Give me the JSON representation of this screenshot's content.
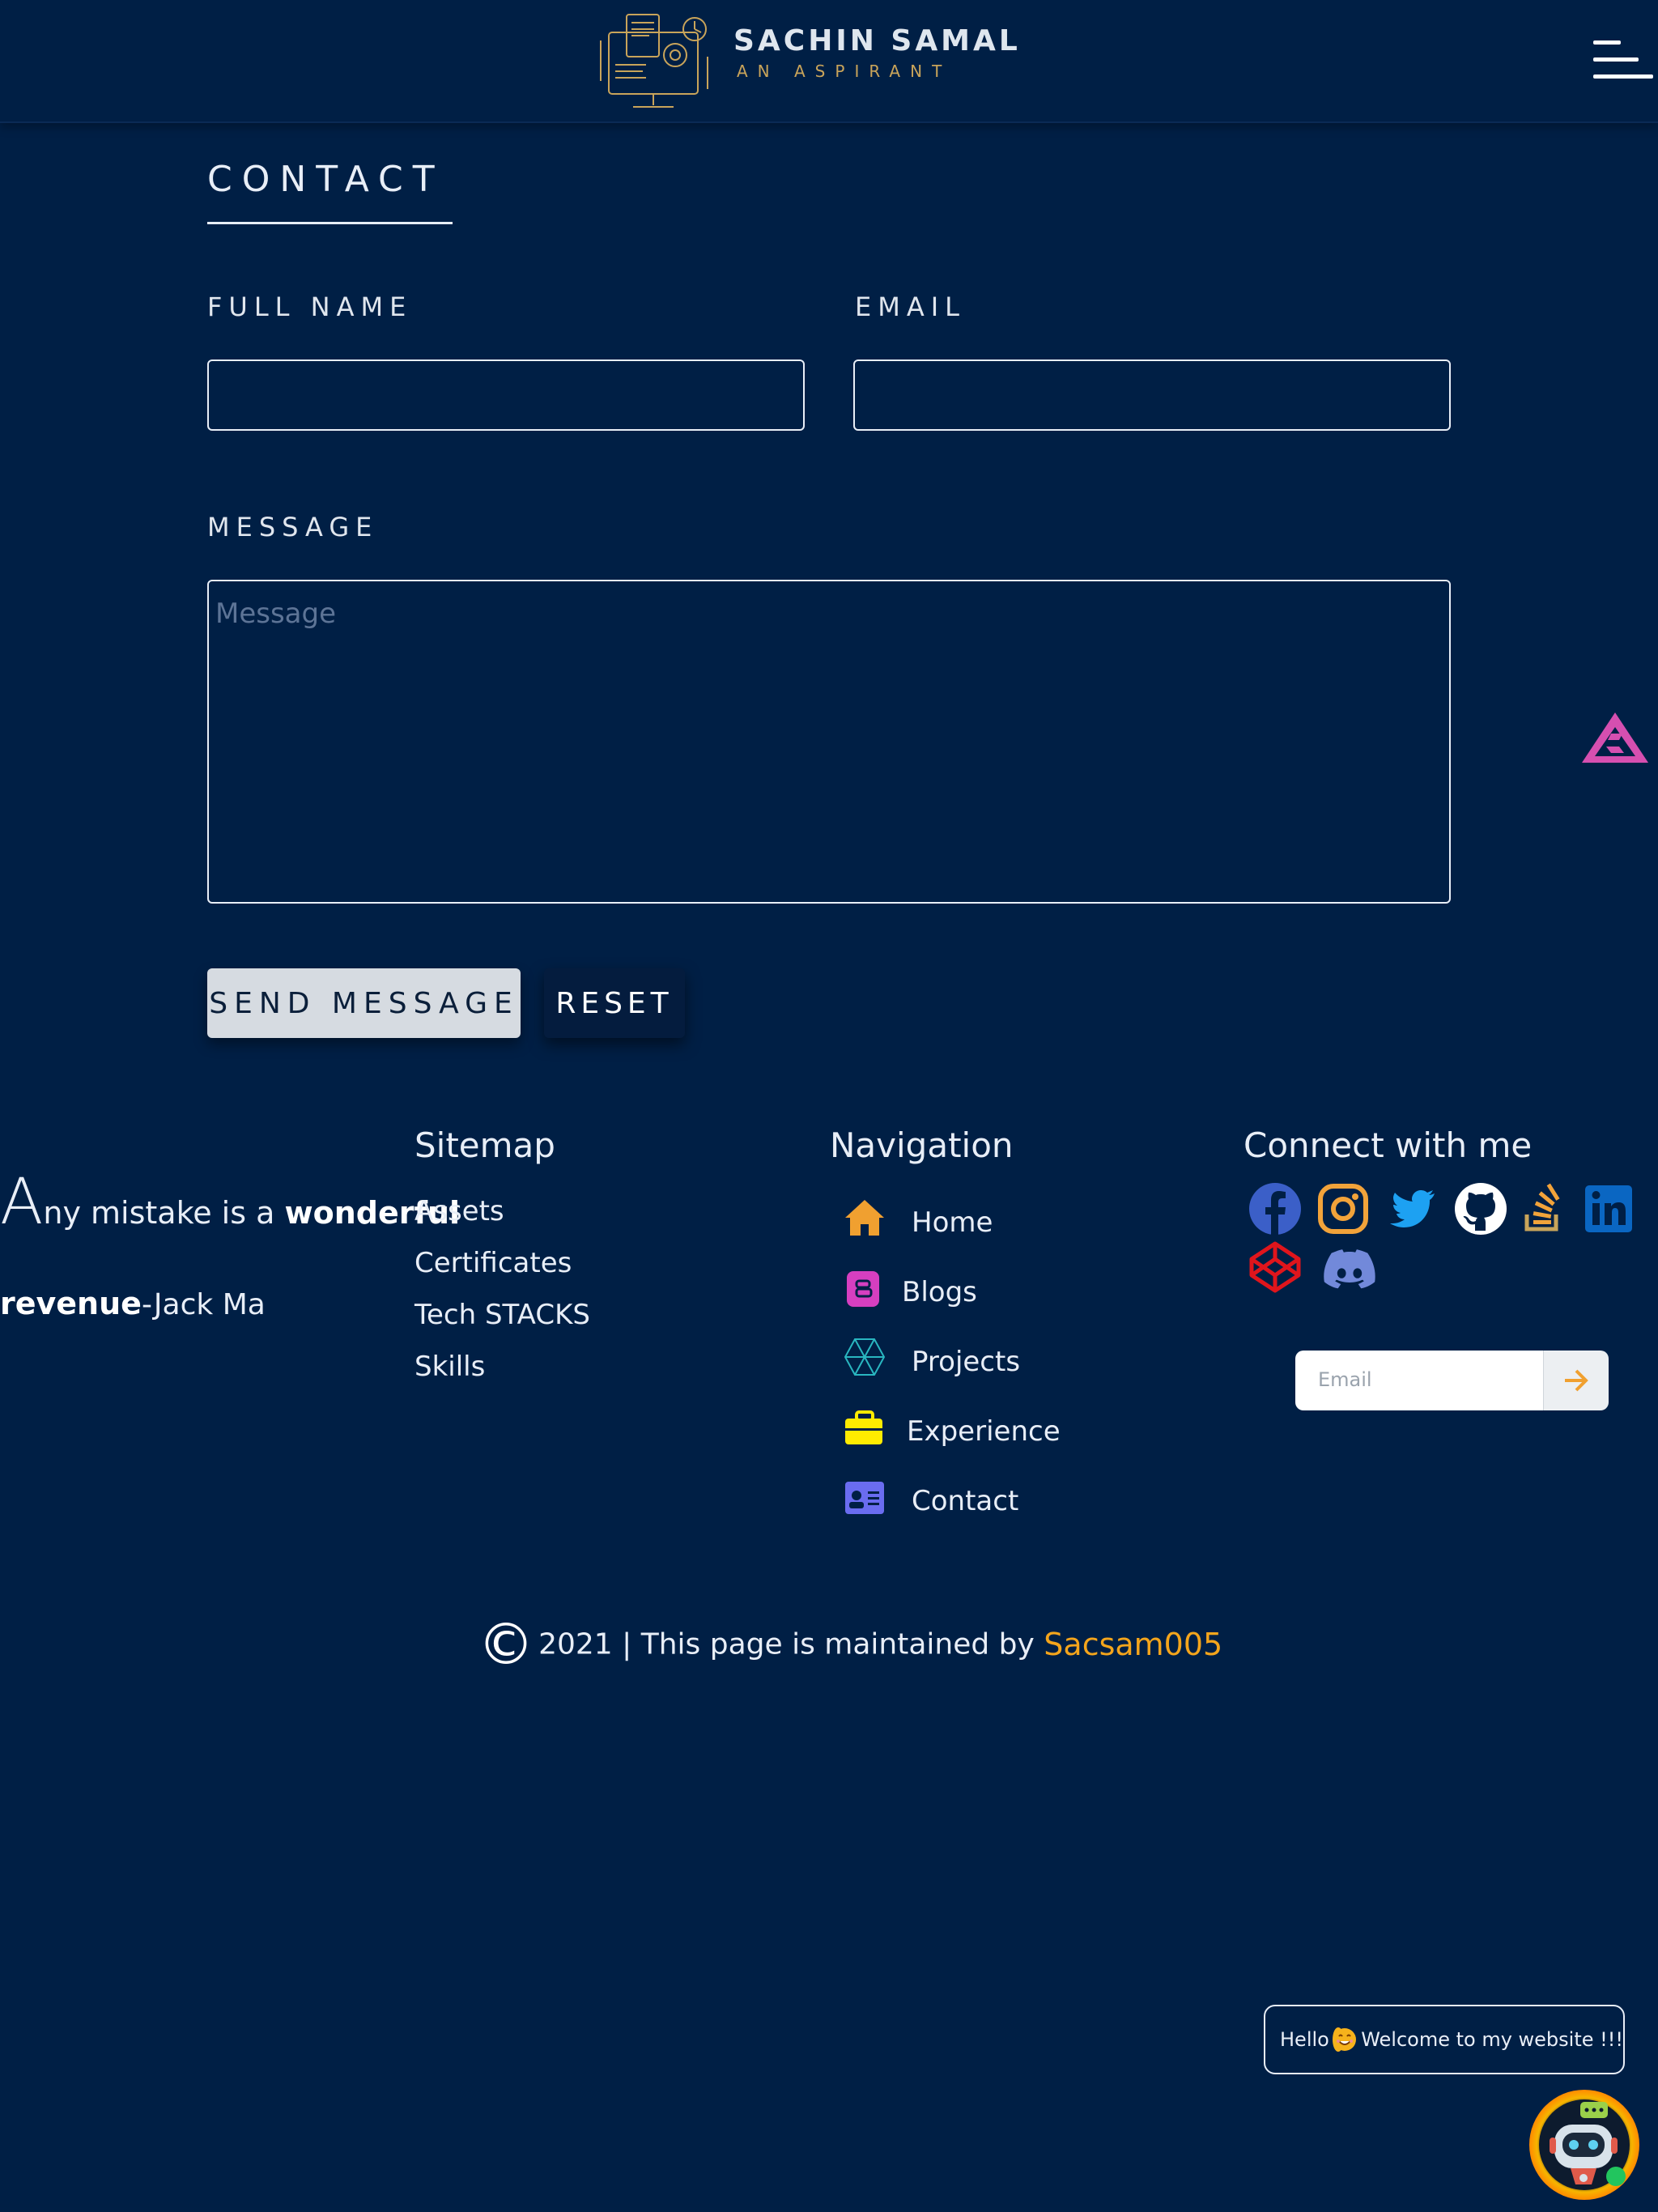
{
  "header": {
    "brand_name": "SACHIN SAMAL",
    "brand_tagline": "AN ASPIRANT",
    "menu_icon": "hamburger-menu-icon"
  },
  "contact": {
    "title": "CONTACT",
    "full_name_label": "FULL NAME",
    "full_name_value": "",
    "email_label": "EMAIL",
    "email_value": "",
    "message_label": "MESSAGE",
    "message_placeholder": "Message",
    "send_button": "SEND MESSAGE",
    "reset_button": "RESET"
  },
  "footer": {
    "quote": {
      "first_letter": "A",
      "part1": "ny mistake is a ",
      "highlight": "wonderful",
      "highlight2": "revenue",
      "author": "-Jack Ma"
    },
    "sitemap": {
      "title": "Sitemap",
      "links": [
        "Assets",
        "Certificates",
        "Tech STACKS",
        "Skills"
      ]
    },
    "navigation": {
      "title": "Navigation",
      "items": [
        {
          "label": "Home",
          "icon": "home-icon",
          "color": "#f0a030"
        },
        {
          "label": "Blogs",
          "icon": "blogger-icon",
          "color": "#d63fc0"
        },
        {
          "label": "Projects",
          "icon": "projects-icon",
          "color": "#29b6c0"
        },
        {
          "label": "Experience",
          "icon": "briefcase-icon",
          "color": "#ffeb00"
        },
        {
          "label": "Contact",
          "icon": "contact-card-icon",
          "color": "#6a6cf0"
        }
      ]
    },
    "connect": {
      "title": "Connect with me",
      "socials": [
        {
          "icon": "facebook-icon",
          "color": "#3b5fc8"
        },
        {
          "icon": "instagram-icon",
          "color": "#f2a33a"
        },
        {
          "icon": "twitter-icon",
          "color": "#1da1f2"
        },
        {
          "icon": "github-icon",
          "color": "#ffffff"
        },
        {
          "icon": "stackoverflow-icon",
          "color": "#f2a33a"
        },
        {
          "icon": "linkedin-icon",
          "color": "#0a66c2"
        },
        {
          "icon": "codepen-icon",
          "color": "#e0151c"
        },
        {
          "icon": "discord-icon",
          "color": "#7289da"
        }
      ],
      "newsletter_placeholder": "Email"
    },
    "copyright": {
      "symbol": "©",
      "text": "2021 | This page is maintained by ",
      "author": "Sacsam005"
    }
  },
  "chat": {
    "greeting_before": "Hello",
    "greeting_after": "! Welcome to my website !!!"
  },
  "colors": {
    "background": "#001f45",
    "accent_orange": "#f4a51c",
    "scroll_top_pink": "#d64fb0"
  }
}
